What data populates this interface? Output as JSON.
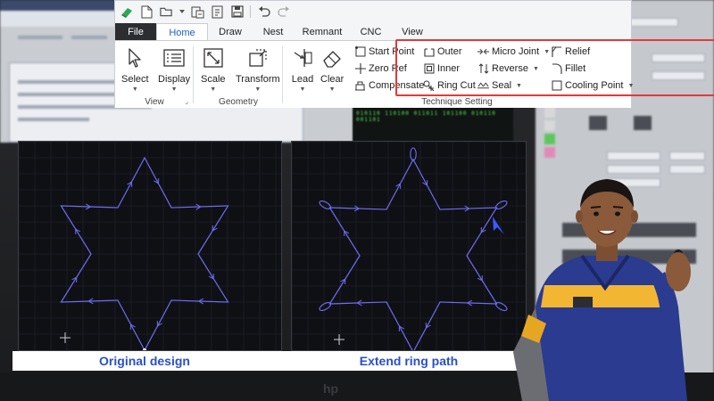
{
  "background": {
    "green_readout": "010110 110100 011011 101100 010110 001101"
  },
  "ribbon": {
    "tabs": [
      {
        "label": "File"
      },
      {
        "label": "Home"
      },
      {
        "label": "Draw"
      },
      {
        "label": "Nest"
      },
      {
        "label": "Remnant"
      },
      {
        "label": "CNC"
      },
      {
        "label": "View"
      }
    ],
    "active_tab": "Home",
    "groups": {
      "view": {
        "label": "View",
        "select": "Select",
        "display": "Display"
      },
      "geometry": {
        "label": "Geometry",
        "scale": "Scale",
        "transform": "Transform"
      },
      "technique": {
        "label": "Technique Setting",
        "lead": "Lead",
        "clear": "Clear",
        "start_point": "Start Point",
        "zero_ref": "Zero Ref",
        "compensate": "Compensate",
        "outer": "Outer",
        "inner": "Inner",
        "ring_cut": "Ring Cut",
        "micro_joint": "Micro Joint",
        "reverse": "Reverse",
        "seal": "Seal",
        "relief": "Relief",
        "fillet": "Fillet",
        "cooling_point": "Cooling Point"
      }
    }
  },
  "comparison": {
    "left_caption": "Original design",
    "right_caption": "Extend ring path"
  },
  "colors": {
    "accent": "#1f5fbf",
    "highlight": "#e23a3a",
    "caption": "#2a4fc7",
    "path": "#6f6cf2",
    "panel_bg": "#0f1014"
  }
}
